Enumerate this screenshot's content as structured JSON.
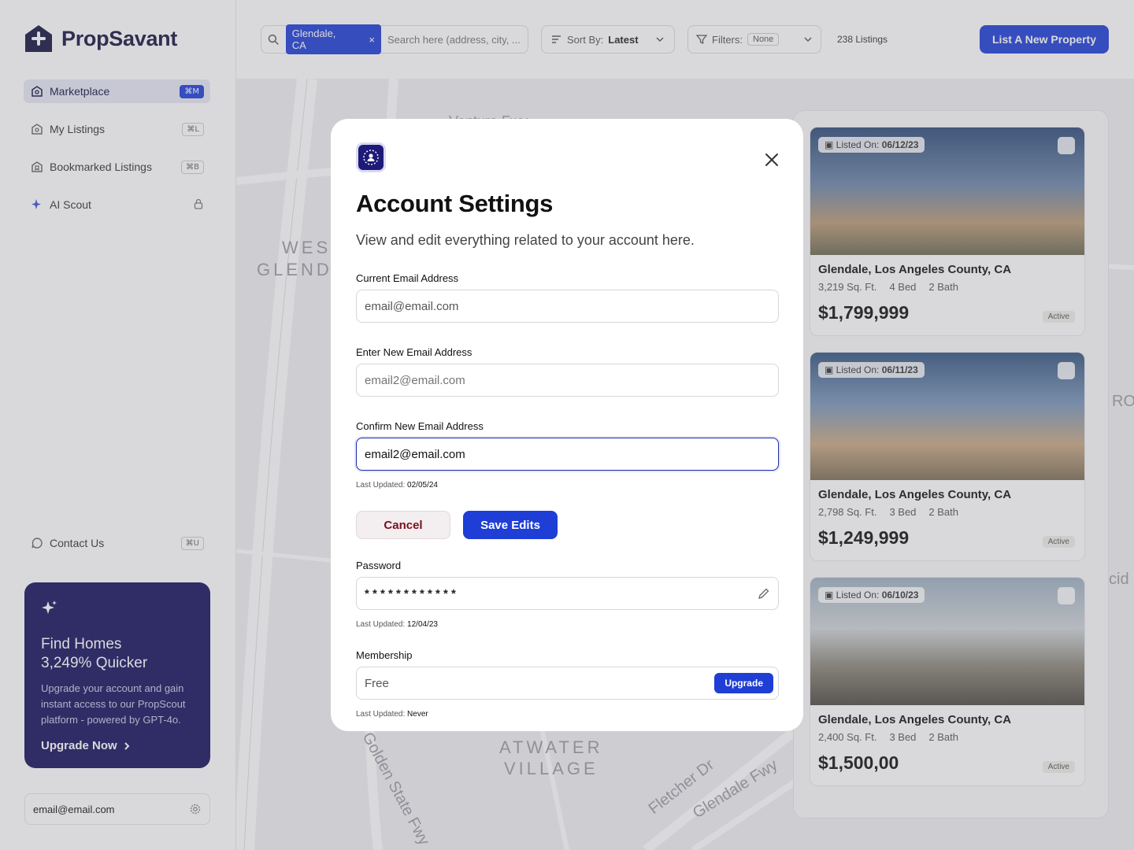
{
  "app": {
    "name": "PropSavant"
  },
  "sidebar": {
    "items": [
      {
        "label": "Marketplace",
        "shortcut": "⌘M"
      },
      {
        "label": "My Listings",
        "shortcut": "⌘L"
      },
      {
        "label": "Bookmarked Listings",
        "shortcut": "⌘B"
      },
      {
        "label": "AI Scout"
      }
    ],
    "contact": {
      "label": "Contact Us",
      "shortcut": "⌘U"
    },
    "promo": {
      "title_line1": "Find Homes",
      "title_line2": "3,249% Quicker",
      "text": "Upgrade your account and gain instant access to our PropScout platform - powered by GPT-4o.",
      "cta": "Upgrade Now"
    },
    "user_email": "email@email.com"
  },
  "topbar": {
    "location_chip": "Glendale, CA",
    "search_placeholder": "Search here (address, city, ...",
    "sort_label": "Sort By:",
    "sort_value": "Latest",
    "filters_label": "Filters:",
    "filters_value": "None",
    "listing_count": "238 Listings",
    "list_button": "List A New Property"
  },
  "map_labels": {
    "west_glendale_1": "WEST",
    "west_glendale_2": "GLENDALE",
    "ventura": "Ventura Fwy",
    "atwater_1": "ATWATER",
    "atwater_2": "VILLAGE",
    "fletcher": "Fletcher Dr",
    "glendale_fwy": "Glendale Fwy",
    "golden_state": "Golden State Fwy",
    "ro": "RO",
    "cid": "cid"
  },
  "listings": [
    {
      "listed_label": "Listed On:",
      "date": "06/12/23",
      "location": "Glendale, Los Angeles County, CA",
      "sqft": "3,219 Sq. Ft.",
      "beds": "4 Bed",
      "baths": "2 Bath",
      "price": "$1,799,999",
      "status": "Active"
    },
    {
      "listed_label": "Listed On:",
      "date": "06/11/23",
      "location": "Glendale, Los Angeles County, CA",
      "sqft": "2,798 Sq. Ft.",
      "beds": "3 Bed",
      "baths": "2 Bath",
      "price": "$1,249,999",
      "status": "Active"
    },
    {
      "listed_label": "Listed On:",
      "date": "06/10/23",
      "location": "Glendale, Los Angeles County, CA",
      "sqft": "2,400 Sq. Ft.",
      "beds": "3 Bed",
      "baths": "2 Bath",
      "price": "$1,500,00",
      "status": "Active"
    }
  ],
  "modal": {
    "title": "Account Settings",
    "subtitle": "View and edit everything related to your account here.",
    "current_email_label": "Current Email Address",
    "current_email_value": "email@email.com",
    "new_email_label": "Enter New Email Address",
    "new_email_placeholder": "email2@email.com",
    "confirm_email_label": "Confirm New Email Address",
    "confirm_email_value": "email2@email.com",
    "last_updated_label": "Last Updated:",
    "email_updated": "02/05/24",
    "cancel": "Cancel",
    "save": "Save Edits",
    "password_label": "Password",
    "password_value": "* * * * * * * * * * * *",
    "password_updated": "12/04/23",
    "membership_label": "Membership",
    "membership_value": "Free",
    "upgrade": "Upgrade",
    "membership_updated": "Never"
  },
  "colors": {
    "brand": "#15123f",
    "accent": "#1e3ed6",
    "promo_bg": "#15105a",
    "cancel_text": "#7a1020"
  }
}
